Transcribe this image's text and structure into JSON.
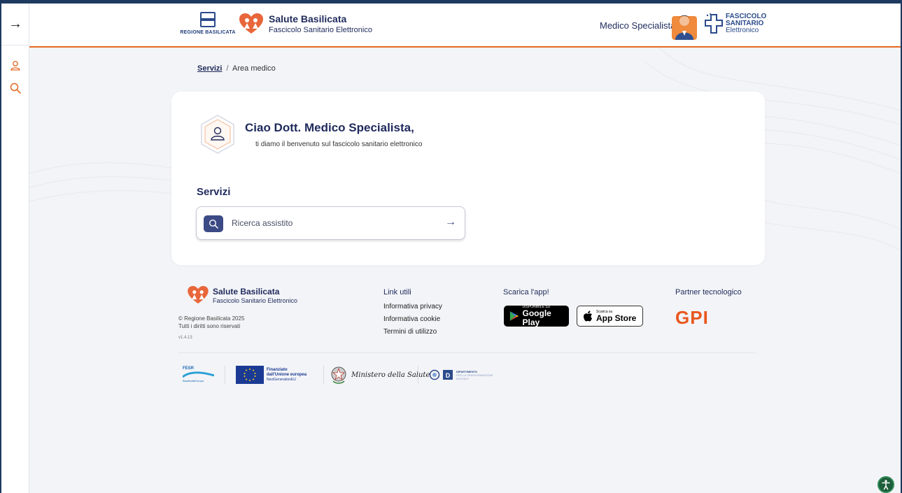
{
  "rail": {
    "expand_glyph": "→",
    "icons": [
      "user-icon",
      "search-icon"
    ]
  },
  "header": {
    "region_logo_text": "REGIONE BASILICATA",
    "brand_title": "Salute Basilicata",
    "brand_subtitle": "Fascicolo Sanitario Elettronico",
    "role": "Medico Specialista",
    "fse_line1": "FASCICOLO",
    "fse_line2": "SANITARIO",
    "fse_line3": "Elettronico"
  },
  "breadcrumb": {
    "root": "Servizi",
    "separator": "/",
    "current": "Area medico"
  },
  "card": {
    "greeting": "Ciao Dott. Medico Specialista,",
    "welcome": "ti diamo il benvenuto sul fascicolo sanitario elettronico",
    "services_heading": "Servizi",
    "search_label": "Ricerca assistito",
    "search_arrow": "→"
  },
  "footer": {
    "brand_title": "Salute Basilicata",
    "brand_subtitle": "Fascicolo Sanitario Elettronico",
    "copyright": "© Regione Basilicata 2025",
    "rights": "Tutti i diritti sono riservati",
    "version": "v1.4.13",
    "links_heading": "Link utili",
    "links": [
      "Informativa privacy",
      "Informativa cookie",
      "Termini di utilizzo"
    ],
    "app_heading": "Scarica l'app!",
    "google_small": "DISPONIBILE SU",
    "google_big": "Google Play",
    "apple_small": "Scarica su",
    "apple_big": "App Store",
    "partner_heading": "Partner tecnologico",
    "partner_name": "GPI",
    "partners": {
      "fesr_line1": "FESR",
      "fesr_line2": "BasilicataEuropa",
      "eu_line1": "Finanziato",
      "eu_line2": "dall'Unione europea",
      "eu_line3": "NextGenerationEU",
      "ministry": "Ministero della Salute",
      "dept_line1": "DIPARTIMENTO",
      "dept_line2": "PER LA TRASFORMAZIONE",
      "dept_line3": "DIGITALE"
    }
  },
  "colors": {
    "navy": "#1f2a5c",
    "accent_orange": "#e36a23",
    "button_navy": "#3c4a86",
    "frame": "#1e3a5f"
  }
}
